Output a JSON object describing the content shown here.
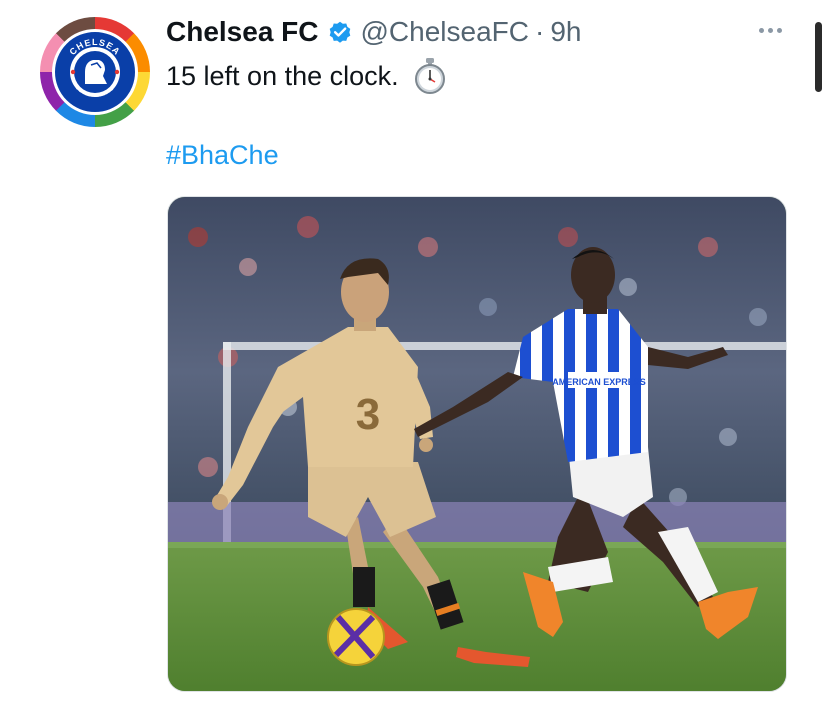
{
  "tweet": {
    "display_name": "Chelsea FC",
    "handle": "@ChelseaFC",
    "separator": "·",
    "time": "9h",
    "text": "15 left on the clock.",
    "hashtag": "#BhaChe"
  },
  "avatar": {
    "top_text": "CHELSEA",
    "bottom_text": "FOOTBALL CLUB"
  },
  "photo": {
    "shirt_number": "3",
    "sponsor": "AMERICAN EXPRESS"
  },
  "icons": {
    "verified": "verified-badge-icon",
    "stopwatch": "stopwatch-icon",
    "more": "more-options-icon"
  },
  "colors": {
    "verified": "#1d9bf0",
    "hashtag": "#1d9bf0",
    "name": "#0f1419",
    "meta": "#536471"
  }
}
